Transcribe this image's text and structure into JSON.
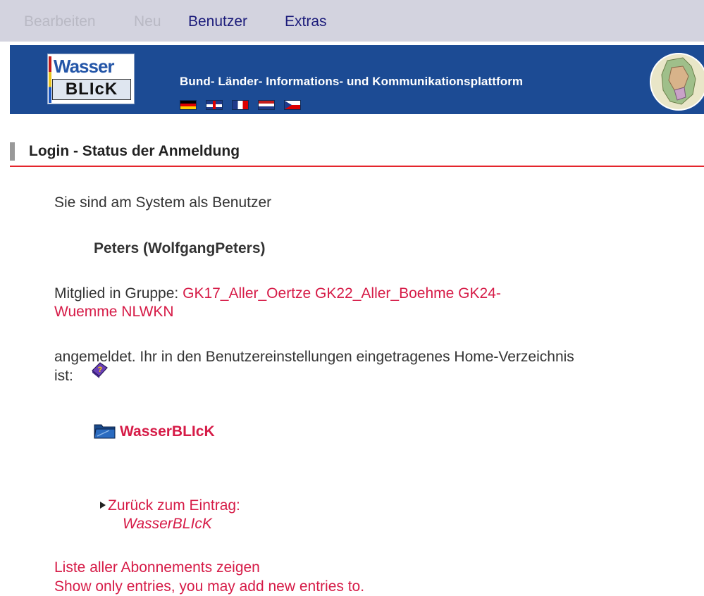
{
  "menu": {
    "items": [
      {
        "label": "Bearbeiten",
        "enabled": false
      },
      {
        "label": "Neu",
        "enabled": false
      },
      {
        "label": "Benutzer",
        "enabled": true
      },
      {
        "label": "Extras",
        "enabled": true
      }
    ]
  },
  "banner": {
    "logo_top": "Wasser",
    "logo_bottom": "BLIcK",
    "tagline": "Bund- Länder- Informations- und Kommunikationsplattform",
    "flags": [
      "de-flag-icon",
      "gb-flag-icon",
      "fr-flag-icon",
      "nl-flag-icon",
      "cz-flag-icon"
    ],
    "background_color": "#1c4b94"
  },
  "section": {
    "title": "Login - Status der Anmeldung",
    "accent_color": "#e4252c"
  },
  "content": {
    "intro": "Sie sind am System als Benutzer",
    "user_name": "Peters (WolfgangPeters)",
    "group_label": "Mitglied in Gruppe:",
    "groups_line1": "GK17_Aller_Oertze GK22_Aller_Boehme GK24-",
    "groups_line2": "Wuemme NLWKN",
    "home_line1": "angemeldet. Ihr in den Benutzereinstellungen eingetragenes Home-Verzeichnis",
    "home_line2": "ist:",
    "home_folder": "WasserBLIcK",
    "back_label": "Zurück zum Eintrag:",
    "back_target": "WasserBLIcK",
    "subscriptions_link": "Liste aller Abonnements zeigen",
    "show_entries_link": "Show only entries, you may add new entries to.",
    "link_color": "#d61b47"
  }
}
